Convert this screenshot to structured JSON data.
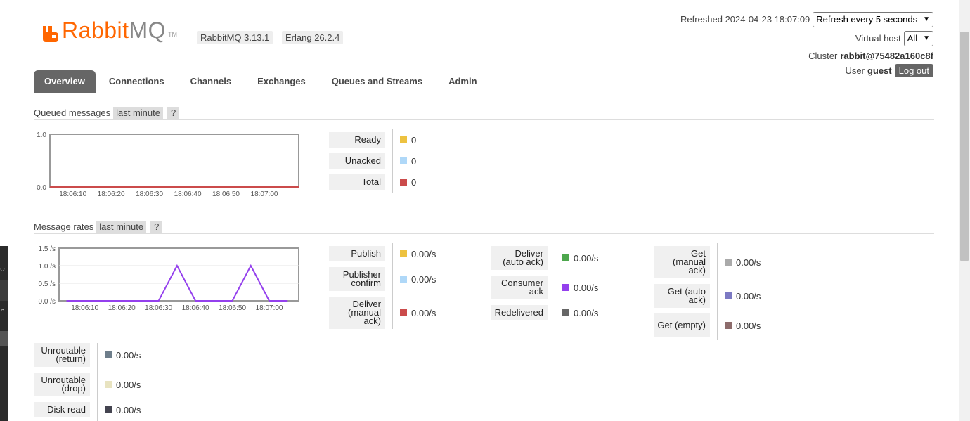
{
  "header": {
    "brand_main": "Rabbit",
    "brand_mq": "MQ",
    "brand_tm": "TM",
    "version": "RabbitMQ 3.13.1",
    "erlang": "Erlang 26.2.4"
  },
  "top_right": {
    "refreshed_label": "Refreshed 2024-04-23 18:07:09",
    "refresh_select": "Refresh every 5 seconds",
    "vhost_label": "Virtual host",
    "vhost_select": "All",
    "cluster_label": "Cluster",
    "cluster_name": "rabbit@75482a160c8f",
    "user_label": "User",
    "user_name": "guest",
    "logout_label": "Log out"
  },
  "tabs": [
    {
      "label": "Overview",
      "active": true
    },
    {
      "label": "Connections",
      "active": false
    },
    {
      "label": "Channels",
      "active": false
    },
    {
      "label": "Exchanges",
      "active": false
    },
    {
      "label": "Queues and Streams",
      "active": false
    },
    {
      "label": "Admin",
      "active": false
    }
  ],
  "queued_messages": {
    "title": "Queued messages",
    "range": "last minute",
    "help": "?",
    "chart_data": {
      "type": "line",
      "y_ticks": [
        "1.0",
        "0.0"
      ],
      "ylim": [
        0,
        1
      ],
      "x_ticks": [
        "18:06:10",
        "18:06:20",
        "18:06:30",
        "18:06:40",
        "18:06:50",
        "18:07:00"
      ],
      "series": [
        {
          "name": "Ready",
          "x": [
            "18:06:04",
            "18:07:09"
          ],
          "values": [
            0,
            0
          ]
        },
        {
          "name": "Unacked",
          "x": [
            "18:06:04",
            "18:07:09"
          ],
          "values": [
            0,
            0
          ]
        },
        {
          "name": "Total",
          "x": [
            "18:06:04",
            "18:07:09"
          ],
          "values": [
            0,
            0
          ]
        }
      ]
    },
    "legend": [
      {
        "label": "Ready",
        "value": "0",
        "color": "#edc240"
      },
      {
        "label": "Unacked",
        "value": "0",
        "color": "#afd8f8"
      },
      {
        "label": "Total",
        "value": "0",
        "color": "#cb4b4b"
      }
    ]
  },
  "message_rates": {
    "title": "Message rates",
    "range": "last minute",
    "help": "?",
    "chart_data": {
      "type": "line",
      "y_ticks": [
        "1.5 /s",
        "1.0 /s",
        "0.5 /s",
        "0.0 /s"
      ],
      "ylim": [
        0,
        1.5
      ],
      "x_ticks": [
        "18:06:10",
        "18:06:20",
        "18:06:30",
        "18:06:40",
        "18:06:50",
        "18:07:00"
      ],
      "series": [
        {
          "name": "Consumer ack",
          "x": [
            "18:06:05",
            "18:06:30",
            "18:06:35",
            "18:06:40",
            "18:06:50",
            "18:06:55",
            "18:07:00",
            "18:07:05"
          ],
          "values": [
            0,
            0,
            1,
            0,
            0,
            1,
            0,
            0
          ]
        }
      ]
    },
    "col1": [
      {
        "label": "Publish",
        "value": "0.00/s",
        "color": "#edc240"
      },
      {
        "label": "Publisher confirm",
        "value": "0.00/s",
        "color": "#afd8f8"
      },
      {
        "label": "Deliver (manual ack)",
        "value": "0.00/s",
        "color": "#cb4b4b"
      }
    ],
    "col2": [
      {
        "label": "Deliver (auto ack)",
        "value": "0.00/s",
        "color": "#4da74d"
      },
      {
        "label": "Consumer ack",
        "value": "0.00/s",
        "color": "#9440ed"
      },
      {
        "label": "Redelivered",
        "value": "0.00/s",
        "color": "#666666"
      }
    ],
    "col3": [
      {
        "label": "Get (manual ack)",
        "value": "0.00/s",
        "color": "#aaaaaa"
      },
      {
        "label": "Get (auto ack)",
        "value": "0.00/s",
        "color": "#7c79c3"
      },
      {
        "label": "Get (empty)",
        "value": "0.00/s",
        "color": "#8d6c6c"
      }
    ],
    "col4": [
      {
        "label": "Unroutable (return)",
        "value": "0.00/s",
        "color": "#6e7e8b"
      },
      {
        "label": "Unroutable (drop)",
        "value": "0.00/s",
        "color": "#e8e3c0"
      },
      {
        "label": "Disk read",
        "value": "0.00/s",
        "color": "#444450"
      }
    ]
  }
}
